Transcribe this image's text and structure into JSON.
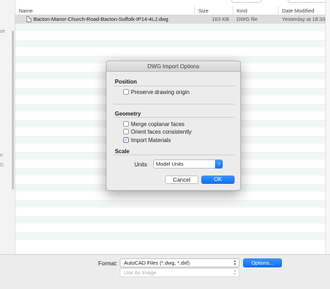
{
  "colors": {
    "accent": "#0d6ef2",
    "selected_row": "#dcdcdc",
    "alt_row": "#f4f5f5",
    "dialog_bg": "#ececec"
  },
  "browser": {
    "sidebar_fragments": [
      "se",
      "e",
      "D"
    ],
    "columns": {
      "name": "Name",
      "size": "Size",
      "kind": "Kind",
      "date": "Date Modified"
    },
    "files": [
      {
        "name": "Bacton-Manor-Church-Road-Bacton-Suffolk-IP14-4LJ.dwg",
        "size": "163 KB",
        "kind": "DWG file",
        "date": "Yesterday at 18:33",
        "icon": "document-icon"
      }
    ]
  },
  "dialog": {
    "title": "DWG Import Options",
    "position_section": "Position",
    "preserve_origin_label": "Preserve drawing origin",
    "preserve_origin_checked": false,
    "geometry_section": "Geometry",
    "merge_coplanar_label": "Merge coplanar faces",
    "merge_coplanar_checked": false,
    "orient_faces_label": "Orient faces consistently",
    "orient_faces_checked": false,
    "import_materials_label": "Import Materials",
    "import_materials_checked": true,
    "scale_section": "Scale",
    "units_label": "Units",
    "units_value": "Model Units",
    "cancel_label": "Cancel",
    "ok_label": "OK"
  },
  "bottom": {
    "format_label": "Format:",
    "format_value": "AutoCAD Files (*.dwg, *.dxf)",
    "use_as_value": "Use As Image",
    "options_label": "Options..."
  }
}
